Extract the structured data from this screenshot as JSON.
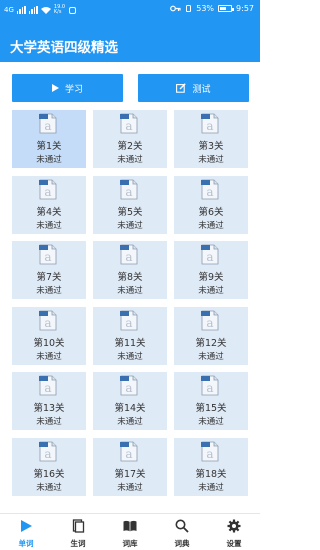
{
  "status_bar": {
    "left_text": "4G",
    "speed": "19.0 K/s",
    "battery": "53%",
    "time": "9:57"
  },
  "app_bar": {
    "title": "大学英语四级精选"
  },
  "actions": {
    "study_label": "学习",
    "test_label": "测试"
  },
  "levels": [
    {
      "name": "第1关",
      "status": "未通过"
    },
    {
      "name": "第2关",
      "status": "未通过"
    },
    {
      "name": "第3关",
      "status": "未通过"
    },
    {
      "name": "第4关",
      "status": "未通过"
    },
    {
      "name": "第5关",
      "status": "未通过"
    },
    {
      "name": "第6关",
      "status": "未通过"
    },
    {
      "name": "第7关",
      "status": "未通过"
    },
    {
      "name": "第8关",
      "status": "未通过"
    },
    {
      "name": "第9关",
      "status": "未通过"
    },
    {
      "name": "第10关",
      "status": "未通过"
    },
    {
      "name": "第11关",
      "status": "未通过"
    },
    {
      "name": "第12关",
      "status": "未通过"
    },
    {
      "name": "第13关",
      "status": "未通过"
    },
    {
      "name": "第14关",
      "status": "未通过"
    },
    {
      "name": "第15关",
      "status": "未通过"
    },
    {
      "name": "第16关",
      "status": "未通过"
    },
    {
      "name": "第17关",
      "status": "未通过"
    },
    {
      "name": "第18关",
      "status": "未通过"
    }
  ],
  "selected_level": "第1关",
  "bottom_nav": [
    {
      "label": "单词",
      "icon": "play-icon"
    },
    {
      "label": "生词",
      "icon": "notes-icon"
    },
    {
      "label": "词库",
      "icon": "book-icon"
    },
    {
      "label": "词典",
      "icon": "search-icon"
    },
    {
      "label": "设置",
      "icon": "gear-icon"
    }
  ],
  "active_tab": "单词",
  "colors": {
    "primary": "#2196f3",
    "cell": "#dfeaf7",
    "cell_active": "#c4dcf7"
  }
}
